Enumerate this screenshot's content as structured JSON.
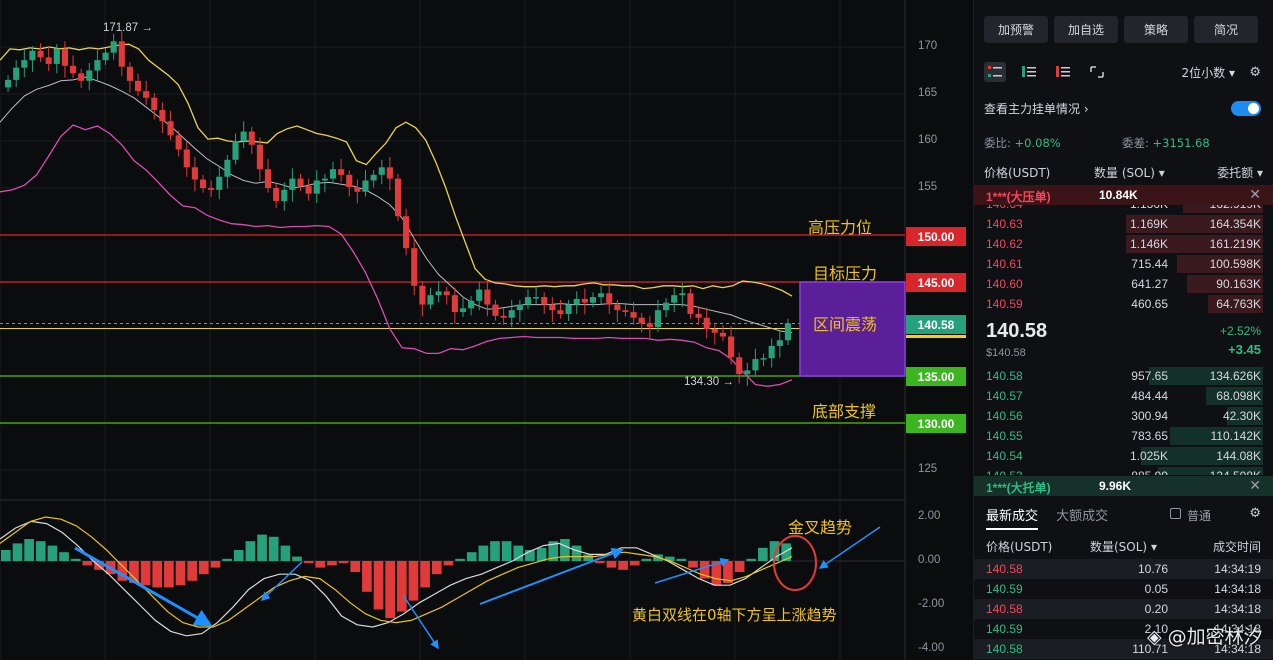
{
  "chart_data": {
    "type": "candlestick",
    "symbol_unit": "USDT",
    "price_axis": {
      "min": 122.5,
      "max": 172.5,
      "ticks": [
        170.0,
        165.0,
        160.0,
        155.0,
        150.0,
        145.0,
        140.0,
        135.0,
        130.0,
        125.0
      ]
    },
    "macd_axis": {
      "min": -4.0,
      "max": 2.0,
      "ticks": [
        "2.00",
        "0.00",
        "-2.00",
        "-4.00"
      ]
    },
    "high_marker": "171.87",
    "low_marker": "134.30",
    "levels": [
      {
        "price": 150,
        "tag": "150.00",
        "label": "高压力位",
        "color": "#d9262b"
      },
      {
        "price": 145,
        "tag": "145.00",
        "label": "目标压力",
        "color": "#d9262b"
      },
      {
        "price": 135,
        "tag": "135.00",
        "label": "",
        "color": "#52c41a"
      },
      {
        "price": 130,
        "tag": "130.00",
        "label": "底部支撑",
        "color": "#52c41a"
      }
    ],
    "range_box": {
      "low": 135,
      "high": 145,
      "label": "区间震荡",
      "color": "#5b1f9a"
    },
    "current_price": {
      "value": 140.58,
      "tag": "140.58",
      "color": "#26a17b"
    },
    "close_series": [
      166.5,
      167.8,
      168.6,
      169.6,
      168.9,
      168.2,
      169.8,
      168.0,
      167.2,
      166.4,
      167.5,
      168.6,
      169.4,
      170.6,
      167.9,
      166.4,
      165.3,
      164.6,
      163.3,
      162.1,
      160.6,
      159.1,
      157.2,
      155.9,
      155.0,
      154.8,
      156.2,
      158.0,
      160.0,
      161.0,
      159.6,
      157.0,
      155.0,
      153.6,
      154.8,
      156.0,
      155.2,
      154.4,
      155.8,
      156.0,
      157.0,
      156.4,
      155.1,
      154.6,
      155.8,
      156.4,
      157.2,
      156.0,
      152.0,
      148.6,
      144.6,
      142.6,
      143.6,
      144.0,
      143.6,
      141.8,
      142.2,
      143.0,
      144.2,
      142.6,
      141.4,
      141.2,
      142.0,
      142.6,
      143.4,
      143.4,
      142.6,
      142.0,
      141.6,
      142.6,
      143.2,
      142.8,
      143.4,
      143.8,
      142.6,
      142.0,
      141.8,
      141.2,
      140.6,
      140.2,
      142.0,
      142.8,
      143.6,
      143.8,
      141.6,
      141.2,
      140.0,
      139.6,
      139.2,
      137.0,
      135.2,
      135.6,
      136.8,
      136.9,
      138.2,
      138.8,
      140.6
    ],
    "bollinger": {
      "upper": [
        168.6,
        169.8,
        169.7,
        169.9,
        169.8,
        170.0,
        169.8,
        169.9,
        169.7,
        169.9,
        169.8,
        170.0,
        170.2,
        170.3,
        169.8,
        168.6,
        167.8,
        167.0,
        166.0,
        164.0,
        161.4,
        160.2,
        160.3,
        160.0,
        159.9,
        160.0,
        159.9,
        159.8,
        160.8,
        161.3,
        161.6,
        161.2,
        160.8,
        160.6,
        160.3,
        159.9,
        157.9,
        157.5,
        158.7,
        159.8,
        161.4,
        162.0,
        161.4,
        160.1,
        157.8,
        155.1,
        152.0,
        149.2,
        146.4,
        145.3,
        144.9,
        144.8,
        144.6,
        144.5,
        144.5,
        144.6,
        144.5,
        144.6,
        144.6,
        144.8,
        144.9,
        144.7,
        144.7,
        144.6,
        144.6,
        144.3,
        144.4,
        144.6,
        144.6,
        144.5,
        144.6,
        144.3,
        144.6,
        144.4,
        144.6,
        145.1,
        145.0,
        144.8,
        144.5,
        144.1,
        143.5
      ],
      "mid": [
        162.0,
        163.5,
        164.8,
        165.5,
        165.9,
        166.4,
        166.5,
        166.8,
        166.4,
        165.9,
        165.3,
        164.6,
        163.6,
        162.6,
        161.6,
        160.4,
        159.2,
        158.1,
        157.3,
        156.4,
        155.8,
        155.5,
        155.7,
        155.4,
        155.0,
        155.2,
        155.5,
        155.6,
        155.4,
        155.2,
        154.8,
        154.1,
        153.2,
        151.8,
        149.6,
        147.5,
        145.8,
        144.6,
        143.4,
        142.6,
        142.1,
        142.2,
        142.4,
        142.6,
        142.6,
        142.6,
        142.7,
        142.6,
        142.6,
        142.6,
        142.7,
        142.7,
        142.6,
        142.6,
        142.6,
        142.6,
        142.6,
        142.4,
        142.1,
        141.8,
        141.5,
        141.0,
        140.6,
        140.2,
        139.8,
        139.6
      ],
      "lower": [
        154.6,
        154.8,
        155.3,
        156.4,
        158.4,
        160.5,
        161.7,
        161.2,
        161.6,
        160.8,
        159.6,
        157.9,
        156.9,
        155.6,
        154.2,
        153.1,
        152.9,
        152.1,
        151.6,
        151.2,
        151.1,
        150.9,
        151.0,
        150.8,
        150.9,
        150.9,
        151.0,
        150.9,
        150.1,
        148.2,
        146.0,
        143.2,
        140.0,
        138.0,
        137.9,
        137.4,
        137.4,
        137.9,
        137.8,
        138.2,
        138.7,
        139.0,
        139.1,
        139.2,
        139.1,
        139.1,
        139.1,
        139.0,
        139.0,
        139.0,
        139.1,
        139.0,
        139.0,
        139.0,
        138.8,
        138.9,
        138.8,
        138.6,
        138.0,
        137.7,
        136.8,
        135.4,
        134.1,
        133.9,
        134.1,
        134.6
      ]
    },
    "macd": {
      "histogram": [
        0.5,
        0.8,
        1.0,
        0.9,
        0.7,
        0.4,
        0.1,
        -0.2,
        -0.4,
        -0.6,
        -0.9,
        -1.0,
        -1.1,
        -1.2,
        -1.2,
        -1.1,
        -0.9,
        -0.6,
        -0.3,
        0.1,
        0.5,
        0.9,
        1.2,
        1.1,
        0.7,
        0.2,
        -0.1,
        -0.3,
        -0.2,
        -0.1,
        -0.5,
        -1.4,
        -2.2,
        -2.6,
        -2.3,
        -1.8,
        -1.2,
        -0.6,
        -0.2,
        0.1,
        0.4,
        0.7,
        0.9,
        0.9,
        0.7,
        0.5,
        0.6,
        0.9,
        1.0,
        0.7,
        0.3,
        -0.1,
        -0.3,
        -0.4,
        -0.2,
        0.1,
        0.3,
        0.2,
        0.1,
        -0.3,
        -0.8,
        -1.1,
        -1.0,
        -0.5,
        0.1,
        0.6,
        0.9,
        0.8
      ],
      "dif": [
        1.0,
        1.5,
        1.8,
        1.7,
        1.3,
        0.7,
        0.0,
        -0.6,
        -1.3,
        -2.0,
        -2.7,
        -3.2,
        -3.4,
        -3.3,
        -2.8,
        -2.1,
        -1.3,
        -0.8,
        -0.6,
        -0.6,
        -0.9,
        -1.6,
        -2.5,
        -2.9,
        -3.0,
        -2.8,
        -2.4,
        -1.9,
        -1.5,
        -1.1,
        -0.8,
        -0.6,
        -0.3,
        0.0,
        0.4,
        0.7,
        0.8,
        0.5,
        0.3,
        0.3,
        0.6,
        0.6,
        0.3,
        0.0,
        -0.4,
        -0.8,
        -1.1,
        -1.1,
        -0.8,
        -0.3,
        0.2,
        0.6
      ],
      "dea": [
        0.8,
        1.3,
        1.8,
        2.0,
        1.9,
        1.6,
        1.1,
        0.5,
        -0.2,
        -0.9,
        -1.6,
        -2.3,
        -2.8,
        -3.0,
        -3.0,
        -2.7,
        -2.2,
        -1.7,
        -1.2,
        -0.9,
        -0.7,
        -0.8,
        -1.3,
        -1.9,
        -2.4,
        -2.7,
        -2.8,
        -2.7,
        -2.4,
        -2.1,
        -1.7,
        -1.3,
        -0.9,
        -0.6,
        -0.3,
        -0.1,
        0.1,
        0.2,
        0.2,
        0.2,
        0.3,
        0.4,
        0.3,
        0.2,
        0.0,
        -0.3,
        -0.6,
        -0.8,
        -0.9,
        -0.7,
        -0.4,
        -0.1,
        0.2
      ]
    },
    "annotations": {
      "golden_cross": "金叉趋势",
      "trend_note": "黄白双线在0轴下方呈上涨趋势"
    }
  },
  "panel": {
    "top_buttons": [
      "加预警",
      "加自选",
      "策略",
      "简况"
    ],
    "decimals": "2位小数",
    "settings_text": "查看主力挂单情况",
    "ratio_label": "委比:",
    "ratio_value": "+0.08%",
    "diff_label": "委差:",
    "diff_value": "+3151.68",
    "columns": {
      "price": "价格(USDT)",
      "qty": "数量 (SOL)",
      "total": "委托额"
    },
    "big_ask": {
      "label": "1***(大压单)",
      "qty": "10.84K"
    },
    "asks": [
      {
        "price": "140.64",
        "qty": "1.136K",
        "total": "162.919K",
        "depth": 0.42
      },
      {
        "price": "140.63",
        "qty": "1.169K",
        "total": "164.354K",
        "depth": 0.72
      },
      {
        "price": "140.62",
        "qty": "1.146K",
        "total": "161.219K",
        "depth": 0.72
      },
      {
        "price": "140.61",
        "qty": "715.44",
        "total": "100.598K",
        "depth": 0.45
      },
      {
        "price": "140.60",
        "qty": "641.27",
        "total": "90.163K",
        "depth": 0.4
      },
      {
        "price": "140.59",
        "qty": "460.65",
        "total": "64.763K",
        "depth": 0.29
      }
    ],
    "last_price": "140.58",
    "last_sub": "$140.58",
    "change_pct": "+2.52%",
    "change_abs": "+3.45",
    "bids": [
      {
        "price": "140.58",
        "qty": "957.65",
        "total": "134.626K",
        "depth": 0.6
      },
      {
        "price": "140.57",
        "qty": "484.44",
        "total": "68.098K",
        "depth": 0.3
      },
      {
        "price": "140.56",
        "qty": "300.94",
        "total": "42.30K",
        "depth": 0.19
      },
      {
        "price": "140.55",
        "qty": "783.65",
        "total": "110.142K",
        "depth": 0.49
      },
      {
        "price": "140.54",
        "qty": "1.025K",
        "total": "144.08K",
        "depth": 0.64
      },
      {
        "price": "140.53",
        "qty": "885.99",
        "total": "124.508K",
        "depth": 0.55
      }
    ],
    "big_bid": {
      "label": "1***(大托单)",
      "qty": "9.96K"
    },
    "trade_tabs": [
      "最新成交",
      "大额成交"
    ],
    "normal_label": "普通",
    "trade_columns": {
      "price": "价格(USDT)",
      "qty": "数量(SOL)",
      "time": "成交时间"
    },
    "trades": [
      {
        "price": "140.58",
        "qty": "10.76",
        "time": "14:34:19",
        "side": "sell"
      },
      {
        "price": "140.59",
        "qty": "0.05",
        "time": "14:34:18",
        "side": "buy"
      },
      {
        "price": "140.58",
        "qty": "0.20",
        "time": "14:34:18",
        "side": "sell"
      },
      {
        "price": "140.59",
        "qty": "2.10",
        "time": "14:34:18",
        "side": "buy"
      },
      {
        "price": "140.58",
        "qty": "110.71",
        "time": "14:34:18",
        "side": "buy"
      }
    ]
  },
  "watermark": "@加密林汐",
  "colors": {
    "up": "#26a17b",
    "down": "#e03a3a",
    "upper_band": "#e8d44d",
    "mid_band": "#b9bcc2",
    "lower_band": "#d84db1",
    "dif": "#d9d9d9",
    "dea": "#e8c21f",
    "arrow": "#1e90ff"
  }
}
